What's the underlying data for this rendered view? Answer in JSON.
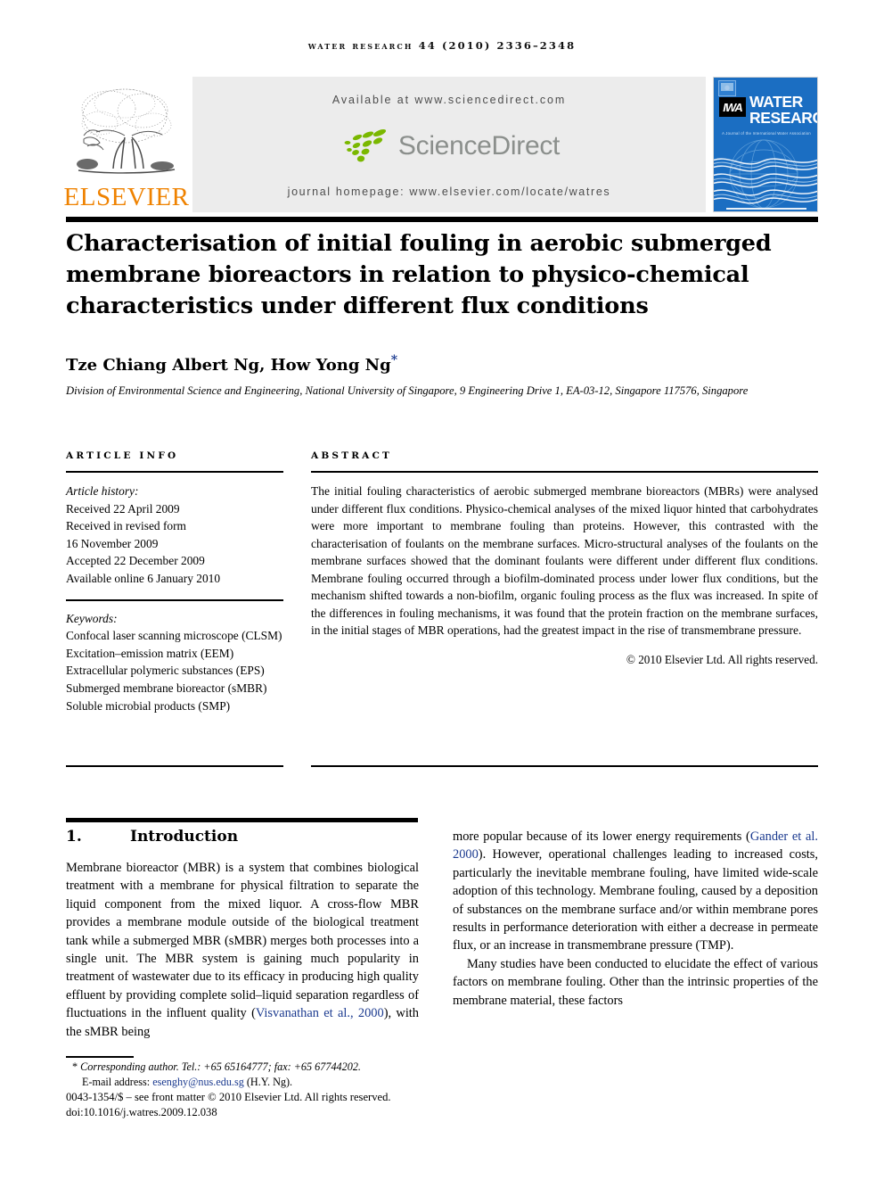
{
  "running_head": "Water research 44 (2010) 2336–2348",
  "masthead": {
    "publisher_name": "ELSEVIER",
    "tree_logo_name": "elsevier-tree-logo",
    "available_at": "Available at www.sciencedirect.com",
    "sciencedirect_wordmark": "ScienceDirect",
    "journal_homepage": "journal homepage: www.elsevier.com/locate/watres",
    "cover": {
      "title_line1": "WATER",
      "title_line2": "RESEARCH",
      "society_logo": "IWA",
      "subtitle": "A Journal of the International Water Association"
    }
  },
  "article": {
    "title": "Characterisation of initial fouling in aerobic submerged membrane bioreactors in relation to physico-chemical characteristics under different flux conditions",
    "authors": "Tze Chiang Albert Ng, How Yong Ng",
    "corresponding_marker": "*",
    "affiliation": "Division of Environmental Science and Engineering, National University of Singapore, 9 Engineering Drive 1, EA-03-12, Singapore 117576, Singapore"
  },
  "article_info": {
    "heading": "article info",
    "history_label": "Article history:",
    "history": [
      "Received 22 April 2009",
      "Received in revised form",
      "16 November 2009",
      "Accepted 22 December 2009",
      "Available online 6 January 2010"
    ],
    "keywords_label": "Keywords:",
    "keywords": [
      "Confocal laser scanning microscope (CLSM)",
      "Excitation–emission matrix (EEM)",
      "Extracellular polymeric substances (EPS)",
      "Submerged membrane bioreactor (sMBR)",
      "Soluble microbial products (SMP)"
    ]
  },
  "abstract": {
    "heading": "abstract",
    "text": "The initial fouling characteristics of aerobic submerged membrane bioreactors (MBRs) were analysed under different flux conditions. Physico-chemical analyses of the mixed liquor hinted that carbohydrates were more important to membrane fouling than proteins. However, this contrasted with the characterisation of foulants on the membrane surfaces. Micro-structural analyses of the foulants on the membrane surfaces showed that the dominant foulants were different under different flux conditions. Membrane fouling occurred through a biofilm-dominated process under lower flux conditions, but the mechanism shifted towards a non-biofilm, organic fouling process as the flux was increased. In spite of the differences in fouling mechanisms, it was found that the protein fraction on the membrane surfaces, in the initial stages of MBR operations, had the greatest impact in the rise of transmembrane pressure.",
    "copyright": "© 2010 Elsevier Ltd. All rights reserved."
  },
  "introduction": {
    "number": "1.",
    "heading": "Introduction",
    "left_paragraph_before_cite": "Membrane bioreactor (MBR) is a system that combines biological treatment with a membrane for physical filtration to separate the liquid component from the mixed liquor. A cross-flow MBR provides a membrane module outside of the biological treatment tank while a submerged MBR (sMBR) merges both processes into a single unit. The MBR system is gaining much popularity in treatment of wastewater due to its efficacy in producing high quality effluent by providing complete solid–liquid separation regardless of fluctuations in the influent quality (",
    "left_citation": "Visvanathan et al., 2000",
    "left_paragraph_after_cite": "), with the sMBR being",
    "right_paragraph1_before_cite": "more popular because of its lower energy requirements (",
    "right_citation": "Gander et al. 2000",
    "right_paragraph1_after_cite": "). However, operational challenges leading to increased costs, particularly the inevitable membrane fouling, have limited wide-scale adoption of this technology. Membrane fouling, caused by a deposition of substances on the membrane surface and/or within membrane pores results in performance deterioration with either a decrease in permeate flux, or an increase in transmembrane pressure (TMP).",
    "right_paragraph2": "Many studies have been conducted to elucidate the effect of various factors on membrane fouling. Other than the intrinsic properties of the membrane material, these factors"
  },
  "footnote": {
    "corresponding": "Corresponding author. Tel.: +65 65164777; fax: +65 67744202.",
    "email_label": "E-mail address:",
    "email": "esenghy@nus.edu.sg",
    "email_suffix": "(H.Y. Ng).",
    "front_matter": "0043-1354/$ – see front matter © 2010 Elsevier Ltd. All rights reserved.",
    "doi": "doi:10.1016/j.watres.2009.12.038"
  },
  "colors": {
    "elsevier_orange": "#ef8200",
    "cover_blue": "#1b6ec2",
    "link_blue": "#1b3a8f",
    "sciencedirect_green": "#7ab800",
    "band_grey": "#ececec"
  }
}
